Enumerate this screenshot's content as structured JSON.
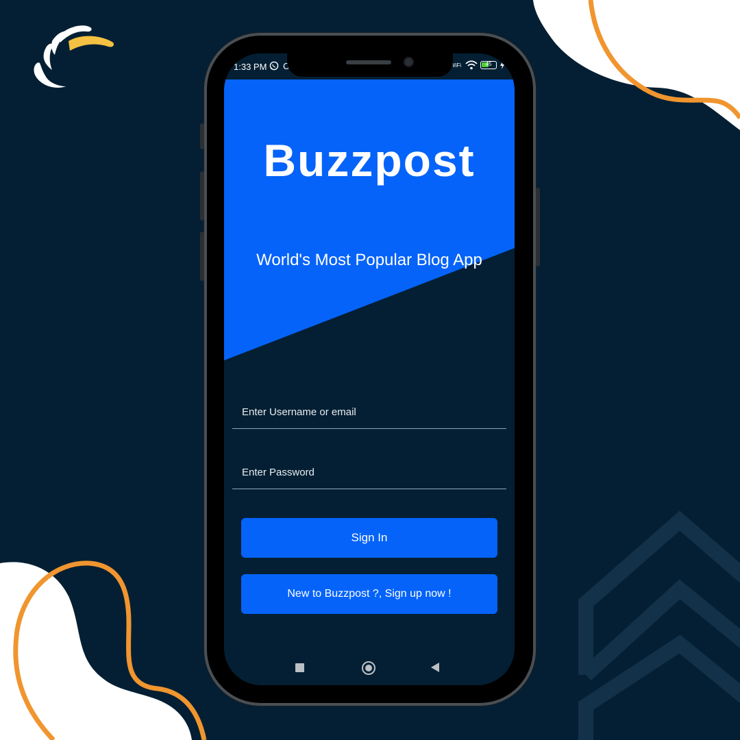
{
  "colors": {
    "background": "#041f33",
    "accent_blue": "#0563f9",
    "orange_line": "#f0952f",
    "white_blob": "#ffffff",
    "brand_yellow": "#f5c142"
  },
  "brand_logo": {
    "icon": "swoosh-logo-icon"
  },
  "status_bar": {
    "time": "1:33 PM",
    "extra_icon": "C",
    "wa_icon": "whatsapp-icon",
    "wifi_label": "WiFi",
    "battery_level": "45"
  },
  "app": {
    "title": "Buzzpost",
    "subtitle": "World's Most Popular Blog App"
  },
  "login_form": {
    "username_placeholder": "Enter Username or email",
    "password_placeholder": "Enter Password",
    "sign_in_label": "Sign In",
    "sign_up_label": "New to Buzzpost ?, Sign up now !"
  },
  "nav_bar": {
    "recent_icon": "square-recents-icon",
    "home_icon": "circle-home-icon",
    "back_icon": "triangle-back-icon"
  }
}
